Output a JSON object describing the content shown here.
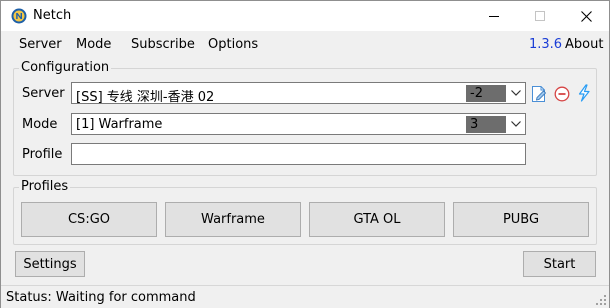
{
  "window": {
    "title": "Netch",
    "icon": "netch-logo-icon"
  },
  "menu": {
    "items": [
      "Server",
      "Mode",
      "Subscribe",
      "Options"
    ],
    "version": "1.3.6",
    "about": "About"
  },
  "configuration": {
    "title": "Configuration",
    "server_label": "Server",
    "server_value": "[SS] 专线 深圳-香港 02",
    "server_latency": "-2",
    "mode_label": "Mode",
    "mode_value": "[1] Warframe",
    "mode_count": "3",
    "profile_label": "Profile",
    "profile_value": "",
    "side_icons": [
      "edit-server-icon",
      "delete-server-icon",
      "speed-test-icon"
    ]
  },
  "profiles": {
    "title": "Profiles",
    "buttons": [
      "CS:GO",
      "Warframe",
      "GTA OL",
      "PUBG"
    ]
  },
  "actions": {
    "settings": "Settings",
    "start": "Start"
  },
  "status": {
    "text": "Status: Waiting for command"
  },
  "colors": {
    "version_link": "#1a3dd6",
    "badge_bg": "#6d6d6d",
    "delete_icon": "#d64545",
    "speed_icon": "#2a9df4"
  }
}
